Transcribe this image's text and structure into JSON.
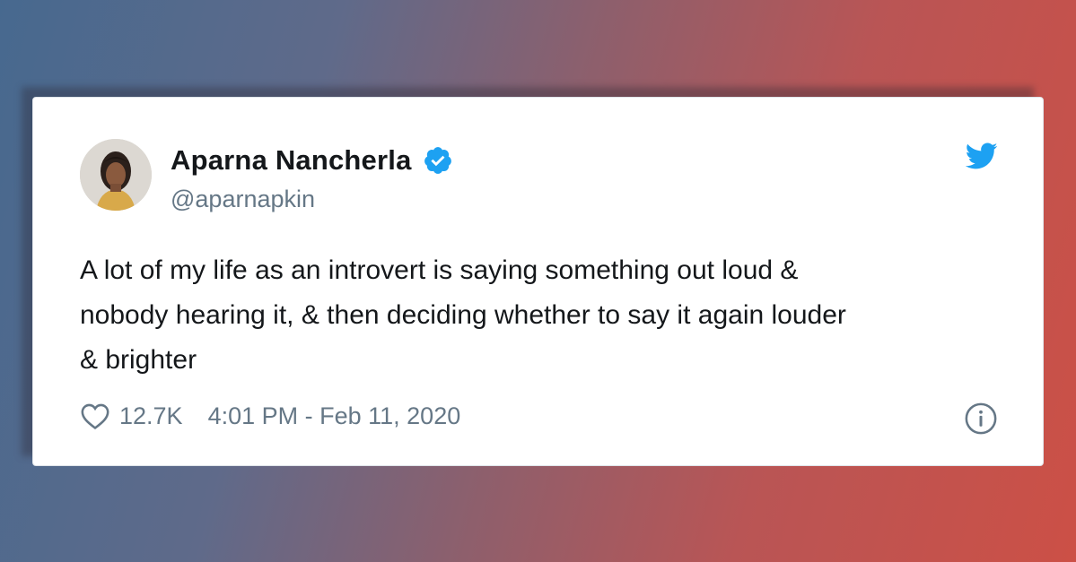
{
  "tweet": {
    "author": {
      "display_name": "Aparna Nancherla",
      "handle": "@aparnapkin",
      "verified": true,
      "avatar_icon": "avatar-photo"
    },
    "text_lines": [
      "A lot of my life as an introvert is saying something out loud &",
      "nobody hearing it, & then deciding whether to say it again louder",
      "& brighter"
    ],
    "likes": "12.7K",
    "timestamp": "4:01 PM - Feb 11, 2020",
    "icons": {
      "brand": "twitter-bird-icon",
      "verified": "verified-badge-icon",
      "like": "heart-icon",
      "info": "info-icon"
    },
    "colors": {
      "brand_blue": "#1da1f2",
      "text_primary": "#14171a",
      "text_secondary": "#657786"
    }
  }
}
